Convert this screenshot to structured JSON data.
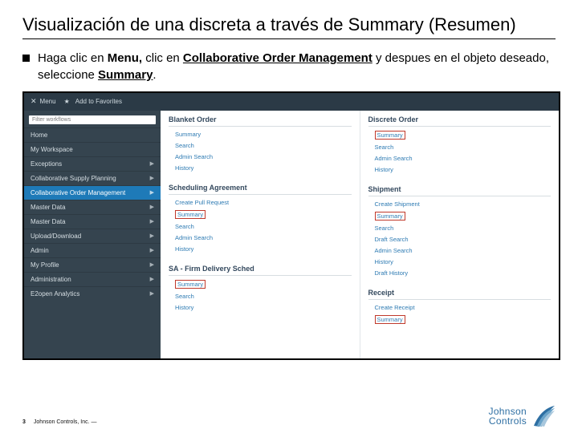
{
  "title": "Visualización de una discreta a través de Summary (Resumen)",
  "bullet": {
    "pre": "Haga clic en ",
    "b1": "Menu,",
    "mid1": " clic en ",
    "b2": "Collaborative Order Management",
    "mid2": " y despues en el objeto deseado, seleccione ",
    "b3": "Summary",
    "end": "."
  },
  "topbar": {
    "menu": "Menu",
    "fav": "Add to Favorites"
  },
  "side": {
    "filter_ph": "Filter workflows",
    "items": [
      {
        "label": "Home",
        "arrow": false
      },
      {
        "label": "My Workspace",
        "arrow": false
      },
      {
        "label": "Exceptions",
        "arrow": true
      },
      {
        "label": "Collaborative Supply Planning",
        "arrow": true
      },
      {
        "label": "Collaborative Order Management",
        "arrow": true,
        "sel": true
      },
      {
        "label": "Master Data",
        "arrow": true
      },
      {
        "label": "Master Data",
        "arrow": true
      },
      {
        "label": "Upload/Download",
        "arrow": true
      },
      {
        "label": "Admin",
        "arrow": true
      },
      {
        "label": "My Profile",
        "arrow": true
      },
      {
        "label": "Administration",
        "arrow": true
      },
      {
        "label": "E2open Analytics",
        "arrow": true
      }
    ]
  },
  "cols": {
    "c1": {
      "hd1": "Blanket Order",
      "g1": [
        "Summary",
        "Search",
        "Admin Search",
        "History"
      ],
      "hd2": "Scheduling Agreement",
      "g2": [
        "Create Pull Request",
        "Summary",
        "Search",
        "Admin Search",
        "History"
      ],
      "hd3": "SA - Firm Delivery Sched",
      "g3": [
        "Summary",
        "Search",
        "History"
      ]
    },
    "c2": {
      "hd1": "Discrete Order",
      "g1": [
        "Summary",
        "Search",
        "Admin Search",
        "History"
      ],
      "hd2": "Shipment",
      "g2": [
        "Create Shipment",
        "Summary",
        "Search",
        "Draft Search",
        "Admin Search",
        "History",
        "Draft History"
      ],
      "hd3": "Receipt",
      "g3": [
        "Create Receipt",
        "Summary"
      ]
    }
  },
  "footer": {
    "page": "3",
    "co": "Johnson Controls, Inc. —"
  },
  "logo": {
    "l1": "Johnson",
    "l2": "Controls"
  }
}
